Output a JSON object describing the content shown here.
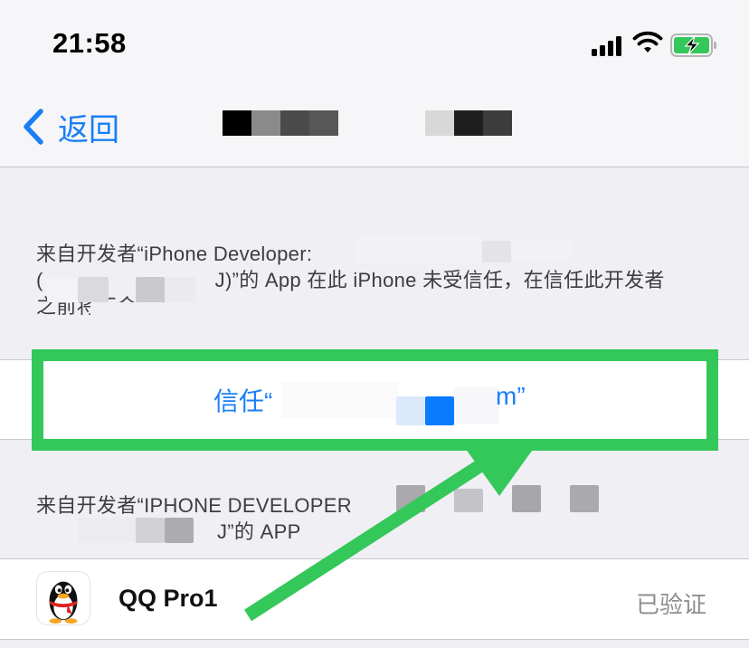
{
  "status_bar": {
    "time": "21:58"
  },
  "nav": {
    "back_label": "返回"
  },
  "trust_section": {
    "description_line1": "来自开发者“iPhone Developer:",
    "description_line1_tail": "...",
    "description_line2_head": "(",
    "description_line2": "J)”的 App 在此 iPhone 未受信任，在信任此开发者",
    "description_line3": "之前将不会运行。",
    "trust_button_label": "信任“",
    "trust_button_suffix": "m”"
  },
  "apps_section": {
    "header_line1": "来自开发者“IPHONE DEVELOPER",
    "header_line2": "J”的 APP",
    "apps": [
      {
        "name": "QQ Pro1",
        "status": "已验证"
      }
    ]
  },
  "colors": {
    "accent": "#1a7ff5",
    "annotation": "#34c759",
    "background": "#efeff4"
  },
  "icons": [
    "back-chevron-icon",
    "cellular-signal-icon",
    "wifi-icon",
    "battery-charging-icon",
    "qq-penguin-icon"
  ]
}
